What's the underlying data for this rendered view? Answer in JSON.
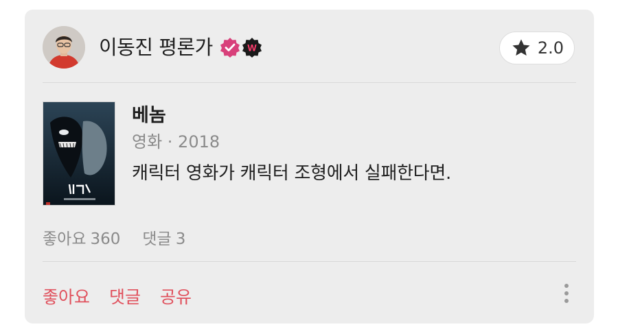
{
  "reviewer": {
    "name": "이동진 평론가",
    "avatar_icon": "reviewer-avatar",
    "badges": [
      "verified-badge-icon",
      "watcha-w-badge-icon"
    ],
    "badge_w_letter": "W",
    "badge_colors": {
      "verified": "#d8407a",
      "w_bg": "#1a1a1a",
      "w_fg": "#ff3d6e"
    }
  },
  "rating": {
    "icon": "star-icon",
    "value": "2.0"
  },
  "movie": {
    "title": "베놈",
    "meta": "영화 · 2018",
    "poster_icon": "movie-poster"
  },
  "review": {
    "text": "캐릭터 영화가 캐릭터 조형에서 실패한다면."
  },
  "stats": {
    "likes_label": "좋아요",
    "likes_count": "360",
    "comments_label": "댓글",
    "comments_count": "3"
  },
  "actions": {
    "like_label": "좋아요",
    "comment_label": "댓글",
    "share_label": "공유",
    "more_icon": "more-vertical-icon",
    "accent_color": "#e0505c"
  }
}
